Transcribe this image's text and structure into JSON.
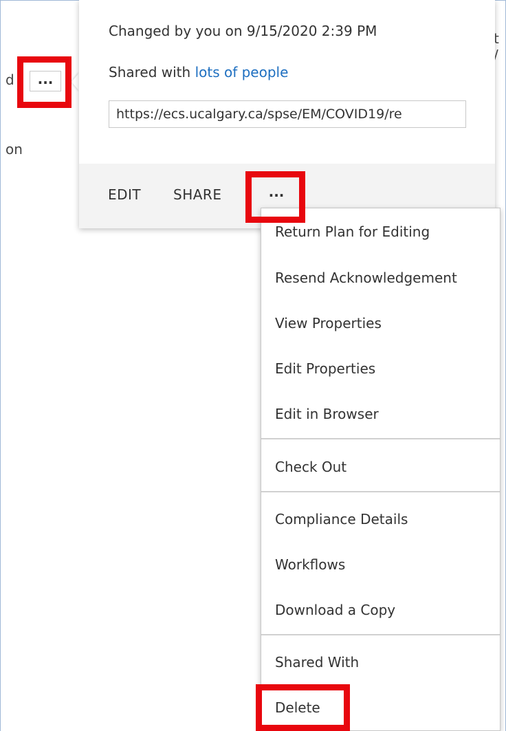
{
  "background": {
    "left_text_1": "d",
    "left_text_2": "on",
    "right_text_1": "t /"
  },
  "row_more_button": "...",
  "callout": {
    "changed_text": "Changed by you on 9/15/2020 2:39 PM",
    "shared_prefix": "Shared with ",
    "shared_link": "lots of people",
    "url": "https://ecs.ucalgary.ca/spse/EM/COVID19/re",
    "edit_label": "EDIT",
    "share_label": "SHARE",
    "more_label": "..."
  },
  "menu": {
    "items": [
      "Return Plan for Editing",
      "Resend Acknowledgement",
      "View Properties",
      "Edit Properties",
      "Edit in Browser",
      "Check Out",
      "Compliance Details",
      "Workflows",
      "Download a Copy",
      "Shared With",
      "Delete"
    ]
  },
  "colors": {
    "highlight": "#e8070e",
    "link": "#1e6fc0",
    "footer_bg": "#f3f3f3"
  }
}
